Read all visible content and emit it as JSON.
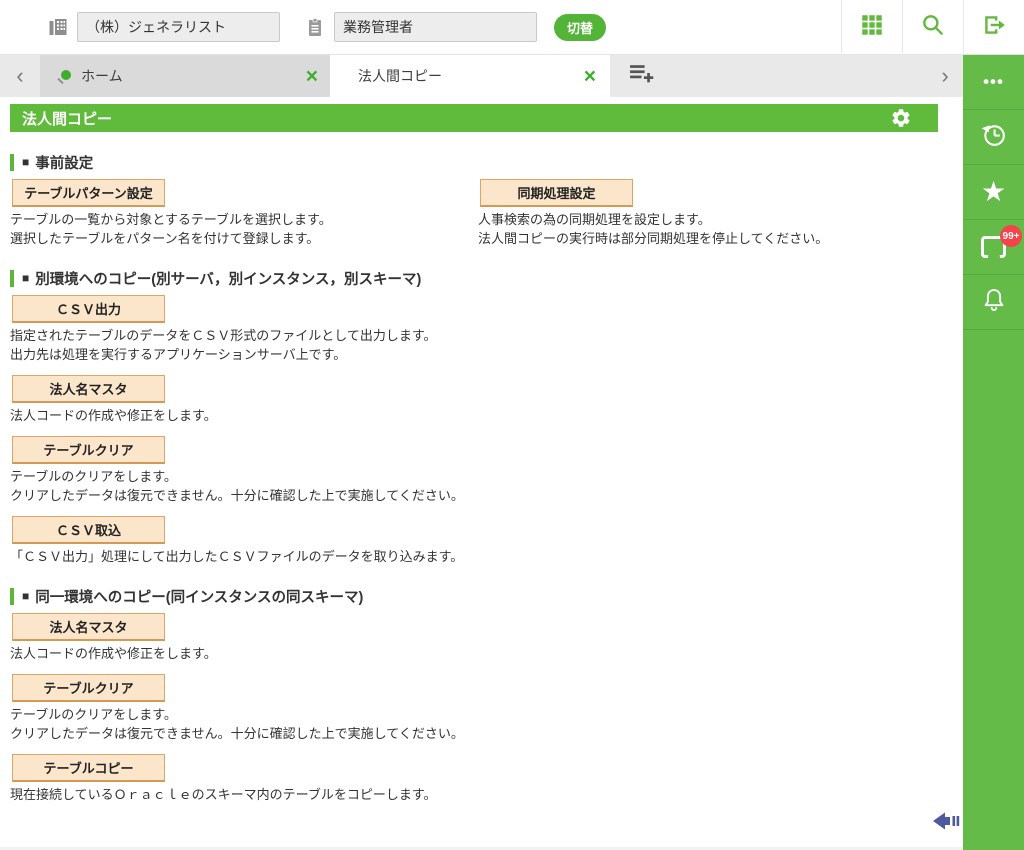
{
  "header": {
    "company_value": "（株）ジェネラリスト",
    "role_value": "業務管理者",
    "switch_button": "切替"
  },
  "tab_bar": {
    "prev_arrow": "‹",
    "next_arrow": "›",
    "tabs": [
      {
        "label": "ホーム",
        "pinned": true,
        "active": false,
        "close": "×"
      },
      {
        "label": "法人間コピー",
        "pinned": false,
        "active": true,
        "close": "×"
      }
    ]
  },
  "page": {
    "title": "法人間コピー"
  },
  "sections": [
    {
      "bullet": "■",
      "heading": "事前設定",
      "items": [
        {
          "button": "テーブルパターン設定",
          "desc": [
            "テーブルの一覧から対象とするテーブルを選択します。",
            "選択したテーブルをパターン名を付けて登録します。"
          ]
        },
        {
          "button": "同期処理設定",
          "desc": [
            "人事検索の為の同期処理を設定します。",
            "法人間コピーの実行時は部分同期処理を停止してください。"
          ]
        }
      ]
    },
    {
      "bullet": "■",
      "heading": "別環境へのコピー(別サーバ，別インスタンス，別スキーマ)",
      "items": [
        {
          "button": "ＣＳＶ出力",
          "desc": [
            "指定されたテーブルのデータをＣＳＶ形式のファイルとして出力します。",
            "出力先は処理を実行するアプリケーションサーバ上です。"
          ]
        },
        {
          "button": "法人名マスタ",
          "desc": [
            "法人コードの作成や修正をします。"
          ]
        },
        {
          "button": "テーブルクリア",
          "desc": [
            "テーブルのクリアをします。",
            "クリアしたデータは復元できません。十分に確認した上で実施してください。"
          ]
        },
        {
          "button": "ＣＳＶ取込",
          "desc": [
            "「ＣＳＶ出力」処理にして出力したＣＳＶファイルのデータを取り込みます。"
          ]
        }
      ]
    },
    {
      "bullet": "■",
      "heading": "同一環境へのコピー(同インスタンスの同スキーマ)",
      "items": [
        {
          "button": "法人名マスタ",
          "desc": [
            "法人コードの作成や修正をします。"
          ]
        },
        {
          "button": "テーブルクリア",
          "desc": [
            "テーブルのクリアをします。",
            "クリアしたデータは復元できません。十分に確認した上で実施してください。"
          ]
        },
        {
          "button": "テーブルコピー",
          "desc": [
            "現在接続しているＯｒａｃｌｅのスキーマ内のテーブルをコピーします。"
          ]
        }
      ]
    }
  ],
  "sidebar": {
    "ellipsis_glyph": "•••",
    "star_glyph": "★",
    "notification_badge": "99+"
  },
  "icons": {
    "header_left": [
      "building-icon",
      "clipboard-icon"
    ],
    "header_right": [
      "apps-grid-icon",
      "search-icon",
      "logout-icon"
    ],
    "tab": [
      "pin-icon",
      "close-icon",
      "add-tab-icon"
    ],
    "title": "gear-icon",
    "sidebar": [
      "ellipsis-icon",
      "history-icon",
      "star-icon",
      "screen-notification-icon",
      "bell-icon"
    ],
    "bottom": "collapse-left-arrow-icon"
  },
  "colors": {
    "brand_green": "#64bb47",
    "switch_green": "#53b438",
    "button_fill": "#fbe6cb",
    "button_border": "#dfa567",
    "badge_red": "#f4434b",
    "collapse_arrow_blue": "#4e5a9e"
  }
}
